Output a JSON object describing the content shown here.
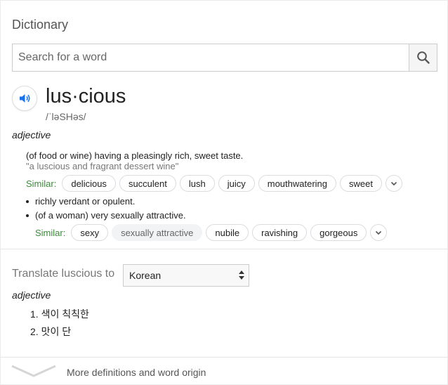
{
  "card": {
    "title": "Dictionary",
    "search": {
      "placeholder": "Search for a word",
      "value": ""
    },
    "word": "lus·cious",
    "phonetic": "/ˈləSHəs/",
    "pos": "adjective",
    "sense1": {
      "definition": "(of food or wine) having a pleasingly rich, sweet taste.",
      "example": "\"a luscious and fragrant dessert wine\"",
      "similar_label": "Similar:",
      "similar": [
        "delicious",
        "succulent",
        "lush",
        "juicy",
        "mouthwatering",
        "sweet"
      ]
    },
    "sense2": {
      "definition": "richly verdant or opulent."
    },
    "sense3": {
      "definition": "(of a woman) very sexually attractive.",
      "similar_label": "Similar:",
      "similar": [
        "sexy",
        "sexually attractive",
        "nubile",
        "ravishing",
        "gorgeous"
      ]
    },
    "translate": {
      "label": "Translate luscious to",
      "language": "Korean",
      "pos": "adjective",
      "items": [
        "1. 색이 칙칙한",
        "2. 맛이 단"
      ]
    },
    "footer": {
      "label": "More definitions and word origin"
    },
    "colors": {
      "similar_green": "#3c8a3c",
      "speaker_blue": "#1a73e8"
    },
    "icons": [
      "search-icon",
      "speaker-icon",
      "chevron-down-icon"
    ]
  }
}
